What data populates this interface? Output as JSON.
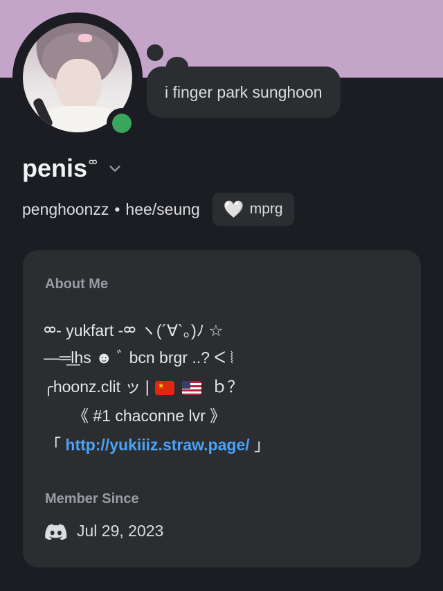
{
  "profile": {
    "display_name": "penis",
    "display_name_suffix": "ᢁ",
    "username": "penghoonzz",
    "separator": "•",
    "pronouns": "hee/seung",
    "status_bubble": "i finger park sunghoon",
    "tag_icon": "🤍",
    "tag_label": "mprg",
    "online_color": "#3ba55d",
    "banner_color": "#c4a4c8"
  },
  "about": {
    "title": "About Me",
    "lines": [
      "ᢁ- yukfart -ᢁ  ヽ(´∀`。)ﾉ ☆",
      "—═͟͟lhs ☻ ﾞ bcn brgr ..? ᐸ ⦚",
      "╭hoonz.clit ッ |",
      "ｂ？",
      "《 #1 chaconne lvr 》",
      "「",
      "http://yukiiiz.straw.page/",
      "」"
    ]
  },
  "member_since": {
    "title": "Member Since",
    "date": "Jul 29, 2023"
  }
}
